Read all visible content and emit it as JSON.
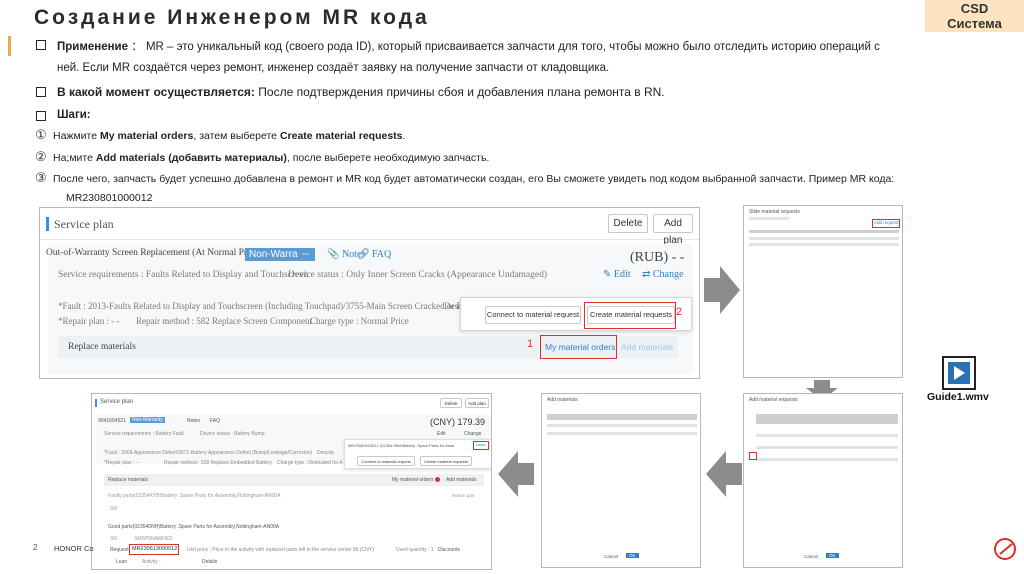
{
  "slide": {
    "title": "Создание Инженером MR кода",
    "badge_line1": "CSD",
    "badge_line2": "Система",
    "page_number": "2",
    "footer_text": "HONOR Co"
  },
  "bullets": {
    "b1_label": "Применение",
    "b1_colon": "：",
    "b1_text_line1": "MR – это уникальный код (своего рода ID), который присваивается запчасти для того, чтобы можно было отследить историю операций с",
    "b1_text_line2": "ней. Если MR создаётся через ремонт, инженер создаёт заявку на получение запчасти от кладовщика.",
    "b2_label": "В какой момент осуществляется:",
    "b2_text": "После подтверждения причины сбоя и добавления плана ремонта в RN.",
    "b3_label": "Шаги:"
  },
  "steps": [
    {
      "num": "①",
      "pre": "Нажмите ",
      "b1": "My material orders",
      "mid": ", затем выберете ",
      "b2": "Create material requests",
      "post": "."
    },
    {
      "num": "②",
      "pre": "На;мите ",
      "b1": "Add materials (добавить материалы)",
      "mid": ", после выберете необходимую запчасть.",
      "b2": "",
      "post": ""
    },
    {
      "num": "③",
      "pre": "После чего, запчасть будет успешно добавлена в ремонт и MR код будет автоматически создан, его Вы сможете увидеть под кодом выбранной запчасти. Пример MR кода:",
      "b1": "",
      "mid": "",
      "b2": "",
      "post": ""
    }
  ],
  "mr_example": "MR230801000012",
  "screenshot_main": {
    "header": "Service plan",
    "delete_btn": "Delete",
    "add_plan_btn": "Add plan",
    "plan_title": "Out-of-Warranty Screen Replacement (At Normal Price)",
    "non_warranty_tag": "Non-Warranty",
    "dash_tag": "--",
    "notes": "Notes",
    "faq": "FAQ",
    "price": "(RUB) - -",
    "service_req": "Service requirements : Faults Related to Display and Touchscreen",
    "device_status": "Device status : Only Inner Screen Cracks (Appearance Undamaged)",
    "edit": "Edit",
    "change": "Change",
    "fault": "*Fault : 2013-Faults Related to Display and Touchscreen (Including Touchpad)/3755-Main Screen Cracked or Broken",
    "desc": "Desc",
    "repair_plan": "*Repair plan : - -",
    "repair_method": "Repair method : 582 Replace Screen Component",
    "charge_type": "Charge type : Normal Price",
    "replace_materials": "Replace materials",
    "connect_btn": "Connect to material request",
    "create_btn": "Create material requests",
    "my_orders": "My material orders",
    "add_materials": "Add materials",
    "marker1": "1",
    "marker2": "2"
  },
  "screenshot_bottom": {
    "header": "Service plan",
    "delete_btn": "Delete",
    "add_plan_btn": "Add plan",
    "plan_code": "9041694521",
    "tag": "Non-Warranty",
    "notes": "Notes",
    "faq": "FAQ",
    "price": "(CNY) 179.39",
    "service_req": "Service requirements : Battery Fault",
    "device_status": "Device status : Battery Bump",
    "edit": "Edit",
    "change": "Change",
    "fault": "*Fault : 2009-Appearance Defect/3071-Battery Appearance Defect (Bump/Leakage/Corrosion)",
    "desc": "Descrip",
    "repair_plan": "*Repair plan : - -",
    "repair_method": "Repair method : 539 Replace Embedded Battery",
    "charge_type": "Charge type : Dedicated for A",
    "popover_title": "MR23081833012 (02354.9NH/Battery .Spare Parts for Assa",
    "used": "Used",
    "connect_btn": "Connect to material request",
    "create_btn": "Create material requests",
    "replace_materials": "Replace materials",
    "my_orders": "My material orders",
    "add_materials": "Add materials",
    "faulty_parts": "Faulty parts(02354KYB)Battery .Spare Parts for Assembly,Nottingham-AN00A",
    "return": "Return part",
    "sn": "SN",
    "good_parts": "Good parts(023540NH)Battery .Spare Parts for Assembly,Nottingham-AN00A",
    "sn2": "SN",
    "sn2_val": "SMSP0NAMHED",
    "request_label": "Request",
    "mr_code": "MR230613000012",
    "unit_price": "Unit price : Price in the activity with replaced parts left in the service center 99 (CNY)",
    "used_qty": "Used quantity : 1",
    "discount": "Discounts",
    "loan": "Loan",
    "activity": "Activity : ",
    "details": "Details"
  },
  "thumb2": {
    "title": "Slide material requests",
    "ok": "Add request"
  },
  "thumb3": {
    "title": "Add materials",
    "ok": "OK",
    "cancel": "Cancel"
  },
  "thumb4": {
    "title": "Add material requests",
    "ok": "OK",
    "cancel": "Cancel"
  },
  "video": {
    "label": "Guide1.wmv"
  },
  "colors": {
    "accent_orange": "#f0a64a",
    "badge_bg": "#fde3bf",
    "highlight_red": "#d9302c",
    "link_blue": "#2f7fd0"
  }
}
